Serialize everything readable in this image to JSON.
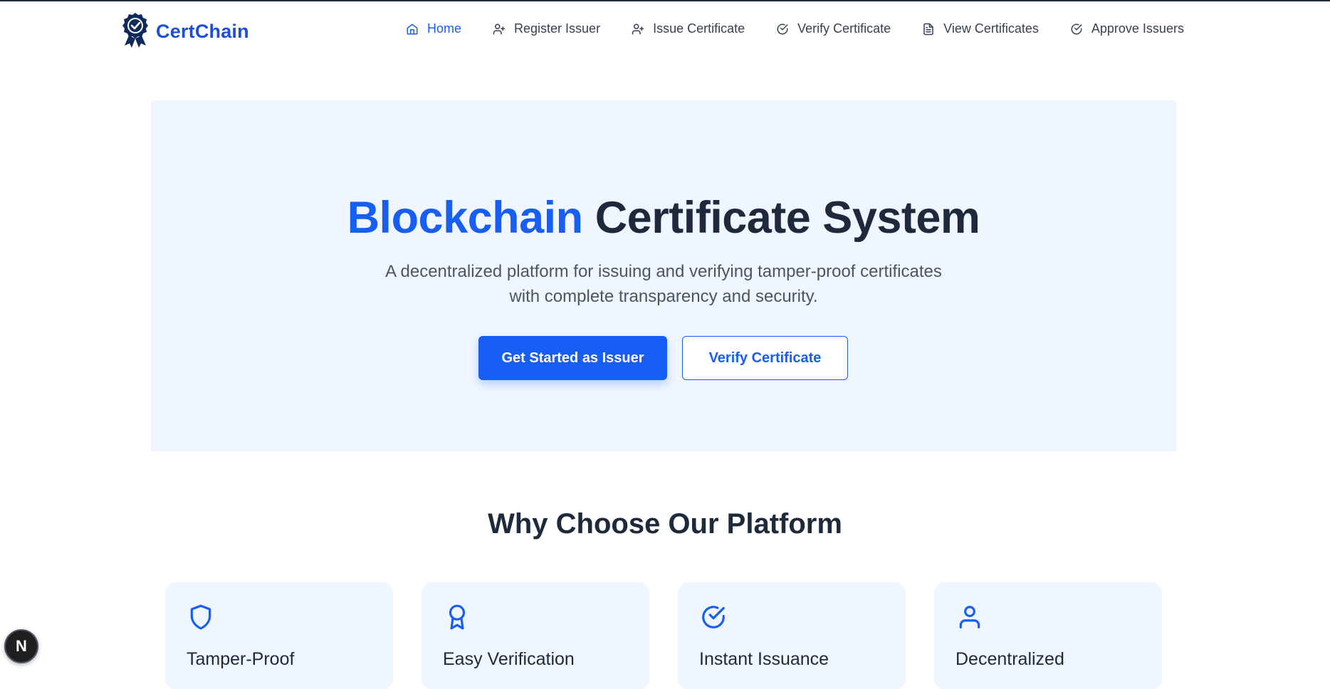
{
  "brand": {
    "name": "CertChain",
    "logo_icon": "award-badge-icon",
    "color": "#1d4ed8"
  },
  "nav": {
    "items": [
      {
        "label": "Home",
        "icon": "home-icon",
        "active": true
      },
      {
        "label": "Register Issuer",
        "icon": "user-plus-icon",
        "active": false
      },
      {
        "label": "Issue Certificate",
        "icon": "user-plus-icon",
        "active": false
      },
      {
        "label": "Verify Certificate",
        "icon": "check-circle-icon",
        "active": false
      },
      {
        "label": "View Certificates",
        "icon": "file-text-icon",
        "active": false
      },
      {
        "label": "Approve Issuers",
        "icon": "check-circle-icon",
        "active": false
      }
    ]
  },
  "hero": {
    "title_accent": "Blockchain",
    "title_rest": "Certificate System",
    "subtitle_line1": "A decentralized platform for issuing and verifying tamper-proof certificates",
    "subtitle_line2": "with complete transparency and security.",
    "primary_button": "Get Started as Issuer",
    "secondary_button": "Verify Certificate"
  },
  "features": {
    "title": "Why Choose Our Platform",
    "cards": [
      {
        "title": "Tamper-Proof",
        "icon": "shield-icon"
      },
      {
        "title": "Easy Verification",
        "icon": "award-icon"
      },
      {
        "title": "Instant Issuance",
        "icon": "check-circle-icon"
      },
      {
        "title": "Decentralized",
        "icon": "user-icon"
      }
    ]
  },
  "floating_badge": {
    "label": "N"
  },
  "colors": {
    "accent": "#175ef5",
    "hero_bg": "#eff6ff",
    "text": "#1e293b",
    "muted": "#4b5563"
  }
}
